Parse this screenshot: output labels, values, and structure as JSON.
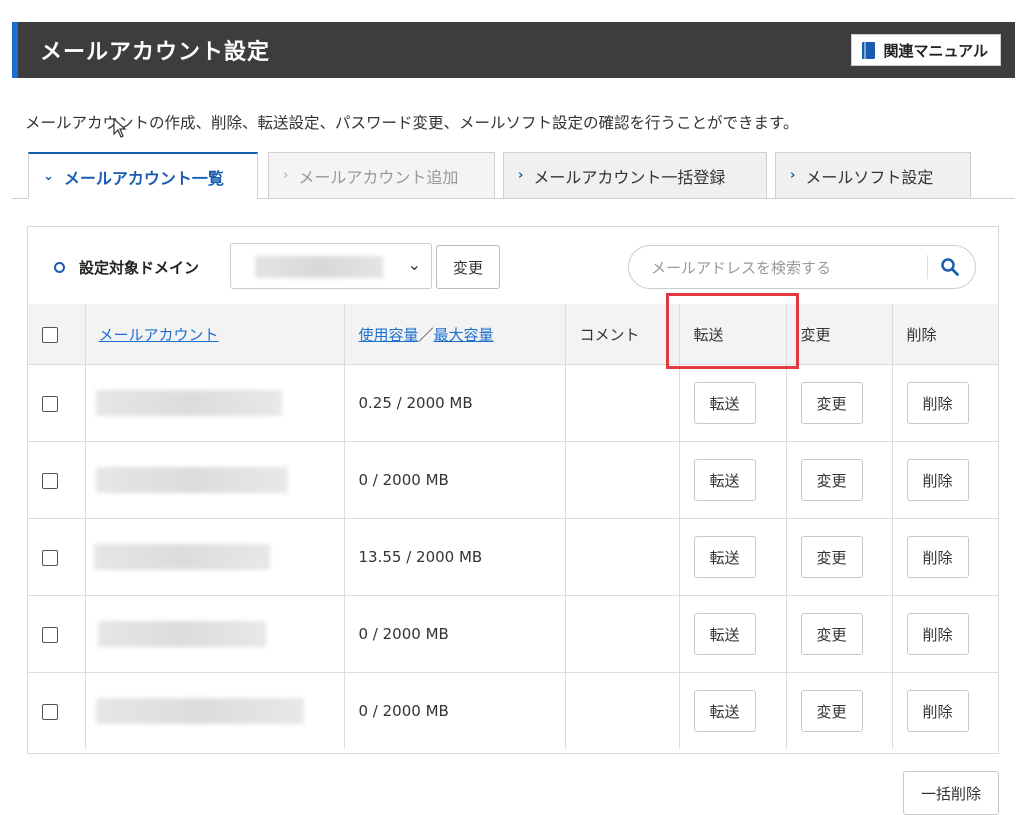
{
  "header": {
    "title": "メールアカウント設定",
    "manual_label": "関連マニュアル"
  },
  "description": "メールアカウントの作成、削除、転送設定、パスワード変更、メールソフト設定の確認を行うことができます。",
  "tabs": [
    {
      "label": "メールアカウント一覧",
      "active": true
    },
    {
      "label": "メールアカウント追加",
      "active": false
    },
    {
      "label": "メールアカウント一括登録",
      "active": false
    },
    {
      "label": "メールソフト設定",
      "active": false
    }
  ],
  "domain": {
    "label": "設定対象ドメイン",
    "change_label": "変更"
  },
  "search": {
    "placeholder": "メールアドレスを検索する"
  },
  "table": {
    "headers": {
      "account": "メールアカウント",
      "usage": "使用容量",
      "separator": "／",
      "max": "最大容量",
      "comment": "コメント",
      "forward": "転送",
      "change": "変更",
      "delete": "削除"
    },
    "rows": [
      {
        "usage": "0.25 / 2000 MB",
        "forward": "転送",
        "change": "変更",
        "delete": "削除"
      },
      {
        "usage": "0 / 2000 MB",
        "forward": "転送",
        "change": "変更",
        "delete": "削除"
      },
      {
        "usage": "13.55 / 2000 MB",
        "forward": "転送",
        "change": "変更",
        "delete": "削除"
      },
      {
        "usage": "0 / 2000 MB",
        "forward": "転送",
        "change": "変更",
        "delete": "削除"
      },
      {
        "usage": "0 / 2000 MB",
        "forward": "転送",
        "change": "変更",
        "delete": "削除"
      }
    ]
  },
  "bulk_delete_label": "一括削除",
  "colors": {
    "header_bg": "#3d3d3d",
    "accent": "#1a5cb0",
    "link": "#1a6fd0",
    "highlight": "#e0393e"
  }
}
